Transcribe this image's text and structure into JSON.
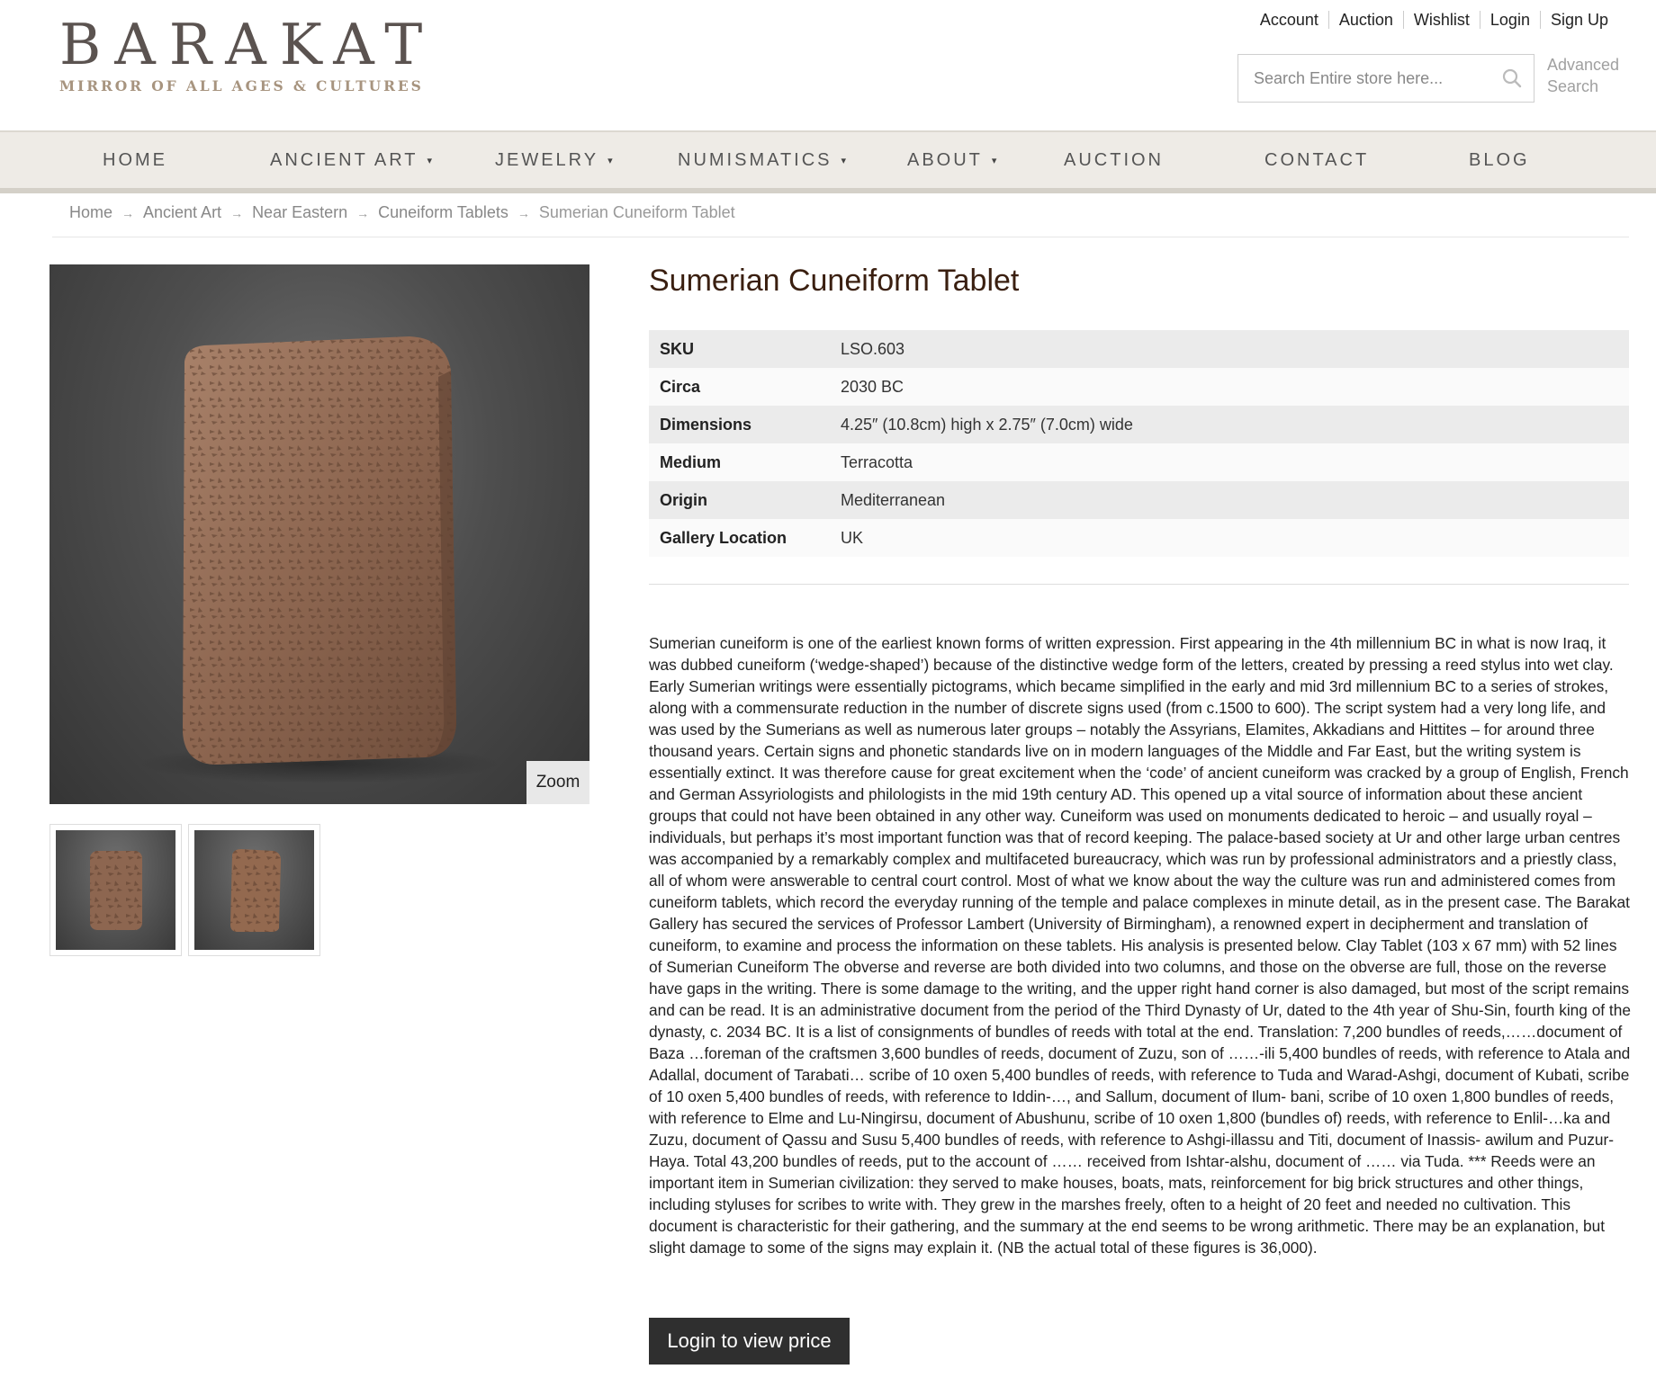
{
  "brand": {
    "name": "BARAKAT",
    "tagline": "MIRROR OF ALL AGES & CULTURES"
  },
  "top_links": [
    "Account",
    "Auction",
    "Wishlist",
    "Login",
    "Sign Up"
  ],
  "search": {
    "placeholder": "Search Entire store here...",
    "value": "",
    "advanced_label": "Advanced Search"
  },
  "nav": {
    "items": [
      {
        "label": "HOME",
        "has_dropdown": false
      },
      {
        "label": "ANCIENT ART",
        "has_dropdown": true
      },
      {
        "label": "JEWELRY",
        "has_dropdown": true
      },
      {
        "label": "NUMISMATICS",
        "has_dropdown": true
      },
      {
        "label": "ABOUT",
        "has_dropdown": true
      },
      {
        "label": "AUCTION",
        "has_dropdown": false
      },
      {
        "label": "CONTACT",
        "has_dropdown": false
      },
      {
        "label": "BLOG",
        "has_dropdown": false
      }
    ],
    "dropdown_glyph": "▾"
  },
  "breadcrumb": {
    "items": [
      "Home",
      "Ancient Art",
      "Near Eastern",
      "Cuneiform Tablets"
    ],
    "current": "Sumerian Cuneiform Tablet",
    "separator": "→"
  },
  "gallery": {
    "zoom_label": "Zoom",
    "thumbnail_count": 2
  },
  "product": {
    "title": "Sumerian Cuneiform Tablet",
    "specs": [
      {
        "label": "SKU",
        "value": "LSO.603"
      },
      {
        "label": "Circa",
        "value": "2030 BC"
      },
      {
        "label": "Dimensions",
        "value": "4.25″ (10.8cm) high x 2.75″ (7.0cm) wide"
      },
      {
        "label": "Medium",
        "value": "Terracotta"
      },
      {
        "label": "Origin",
        "value": "Mediterranean"
      },
      {
        "label": "Gallery Location",
        "value": "UK"
      }
    ],
    "description": "Sumerian cuneiform is one of the earliest known forms of written expression. First appearing in the 4th millennium BC in what is now Iraq, it was dubbed cuneiform (‘wedge-shaped’) because of the distinctive wedge form of the letters, created by pressing a reed stylus into wet clay. Early Sumerian writings were essentially pictograms, which became simplified in the early and mid 3rd millennium BC to a series of strokes, along with a commensurate reduction in the number of discrete signs used (from c.1500 to 600). The script system had a very long life, and was used by the Sumerians as well as numerous later groups – notably the Assyrians, Elamites, Akkadians and Hittites – for around three thousand years. Certain signs and phonetic standards live on in modern languages of the Middle and Far East, but the writing system is essentially extinct. It was therefore cause for great excitement when the ‘code’ of ancient cuneiform was cracked by a group of English, French and German Assyriologists and philologists in the mid 19th century AD. This opened up a vital source of information about these ancient groups that could not have been obtained in any other way. Cuneiform was used on monuments dedicated to heroic – and usually royal – individuals, but perhaps it’s most important function was that of record keeping. The palace-based society at Ur and other large urban centres was accompanied by a remarkably complex and multifaceted bureaucracy, which was run by professional administrators and a priestly class, all of whom were answerable to central court control. Most of what we know about the way the culture was run and administered comes from cuneiform tablets, which record the everyday running of the temple and palace complexes in minute detail, as in the present case. The Barakat Gallery has secured the services of Professor Lambert (University of Birmingham), a renowned expert in decipherment and translation of cuneiform, to examine and process the information on these tablets. His analysis is presented below. Clay Tablet (103 x 67 mm) with 52 lines of Sumerian Cuneiform The obverse and reverse are both divided into two columns, and those on the obverse are full, those on the reverse have gaps in the writing. There is some damage to the writing, and the upper right hand corner is also damaged, but most of the script remains and can be read. It is an administrative document from the period of the Third Dynasty of Ur, dated to the 4th year of Shu-Sin, fourth king of the dynasty, c. 2034 BC. It is a list of consignments of bundles of reeds with total at the end. Translation: 7,200 bundles of reeds,……document of Baza …foreman of the craftsmen 3,600 bundles of reeds, document of Zuzu, son of ……-ili 5,400 bundles of reeds, with reference to Atala and Adallal, document of Tarabati… scribe of 10 oxen 5,400 bundles of reeds, with reference to Tuda and Warad-Ashgi, document of Kubati, scribe of 10 oxen 5,400 bundles of reeds, with reference to Iddin-…, and Sallum, document of Ilum- bani, scribe of 10 oxen 1,800 bundles of reeds, with reference to Elme and Lu-Ningirsu, document of Abushunu, scribe of 10 oxen 1,800 (bundles of) reeds, with reference to Enlil-…ka and Zuzu, document of Qassu and Susu 5,400 bundles of reeds, with reference to Ashgi-illassu and Titi, document of Inassis- awilum and Puzur-Haya. Total 43,200 bundles of reeds, put to the account of …… received from Ishtar-alshu, document of …… via Tuda. *** Reeds were an important item in Sumerian civilization: they served to make houses, boats, mats, reinforcement for big brick structures and other things, including styluses for scribes to write with. They grew in the marshes freely, often to a height of 20 feet and needed no cultivation. This document is characteristic for their gathering, and the summary at the end seems to be wrong arithmetic. There may be an explanation, but slight damage to some of the signs may explain it. (NB the actual total of these figures is 36,000).",
    "cta_label": "Login to view price"
  },
  "colors": {
    "nav_bg": "#eeebe6",
    "title": "#3a1f10",
    "button_bg": "#2f2f2f",
    "tagline": "#a7947f"
  }
}
